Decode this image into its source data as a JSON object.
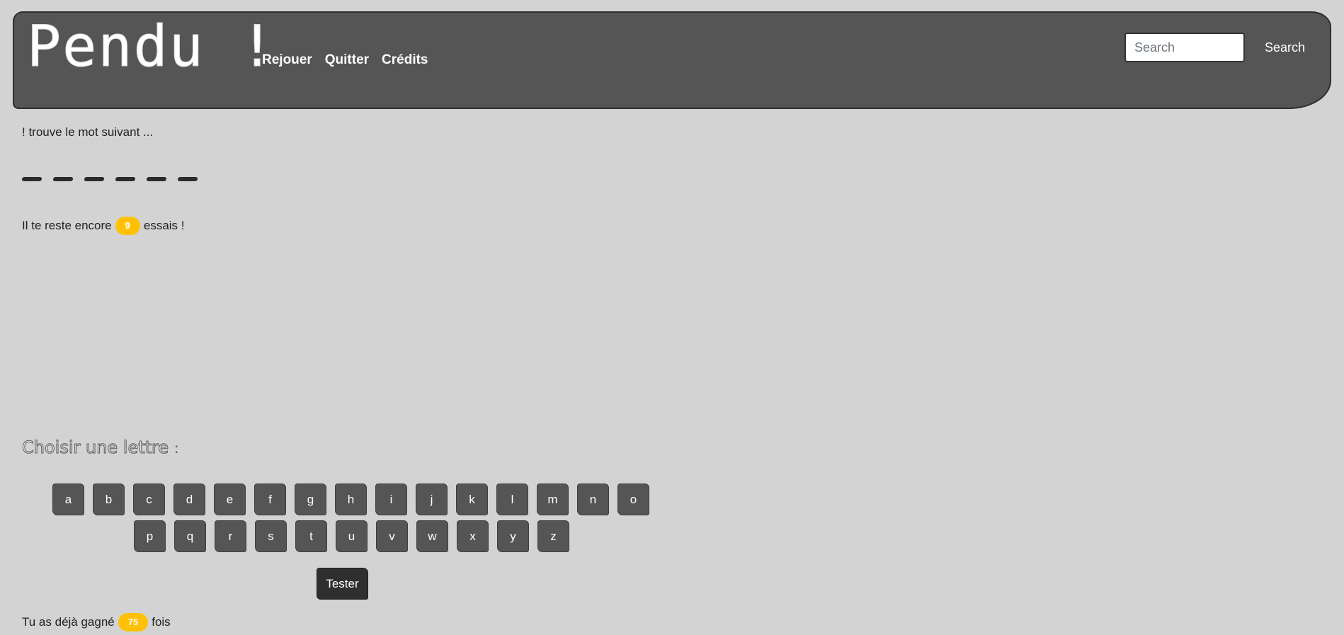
{
  "navbar": {
    "brand": "Pendu !",
    "links": [
      {
        "label": "Rejouer"
      },
      {
        "label": "Quitter"
      },
      {
        "label": "Crédits"
      }
    ],
    "search_placeholder": "Search",
    "search_button": "Search"
  },
  "game": {
    "intro": "! trouve le mot suivant ...",
    "word_blanks": 6,
    "tries_prefix": "Il te reste encore",
    "tries_remaining": "9",
    "tries_suffix": "essais !",
    "choose_title": "Choisir une lettre",
    "choose_colon": ":",
    "keyboard_row1": [
      "a",
      "b",
      "c",
      "d",
      "e",
      "f",
      "g",
      "h",
      "i",
      "j",
      "k",
      "l",
      "m",
      "n",
      "o"
    ],
    "keyboard_row2": [
      "p",
      "q",
      "r",
      "s",
      "t",
      "u",
      "v",
      "w",
      "x",
      "y",
      "z"
    ],
    "tester_label": "Tester",
    "wins_prefix": "Tu as déjà gagné",
    "wins_count": "75",
    "wins_suffix": "fois"
  },
  "colors": {
    "background": "#d3d3d3",
    "navbar": "#555555",
    "badge": "#ffc107",
    "key": "#555555",
    "tester": "#2f2f2f"
  }
}
